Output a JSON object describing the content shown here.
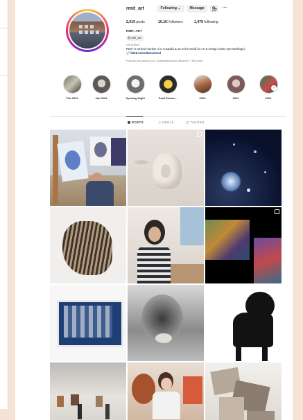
{
  "profile": {
    "username": "rmit_art",
    "following_btn": "Following ⌄",
    "message_btn": "Message",
    "adduser_icon": "add-user-icon",
    "more_icon": "more-icon",
    "posts_count": "2,019",
    "posts_label": " posts",
    "followers_count": "10.1K",
    "followers_label": " followers",
    "following_count": "1,475",
    "following_label": " following",
    "display_name": "RMIT: ART",
    "threads_handle": "@ rmit_art",
    "category": "Art school",
    "bio": "RMIT is ranked number 1 in Australia & 15 in the world for Art & Design (2022 QS Rankings).",
    "link": "🔗 linktr.ee/rmitartschool",
    "followed_by": "Followed by studios_ivo, mollieamehavald, artsamm + 304 more"
  },
  "highlights": [
    {
      "label": "Feb 2024"
    },
    {
      "label": "Jan 2024"
    },
    {
      "label": "Opening Night"
    },
    {
      "label": "Grad Showc..."
    },
    {
      "label": "2023"
    },
    {
      "label": "2022"
    },
    {
      "label": "2021"
    }
  ],
  "tabs": {
    "posts": "▦ POSTS",
    "reels": "▷ REELS",
    "tagged": "◫ TAGGED"
  },
  "colors": {
    "page_bg": "#f6e3d6",
    "link": "#00376b",
    "muted": "#737373"
  }
}
